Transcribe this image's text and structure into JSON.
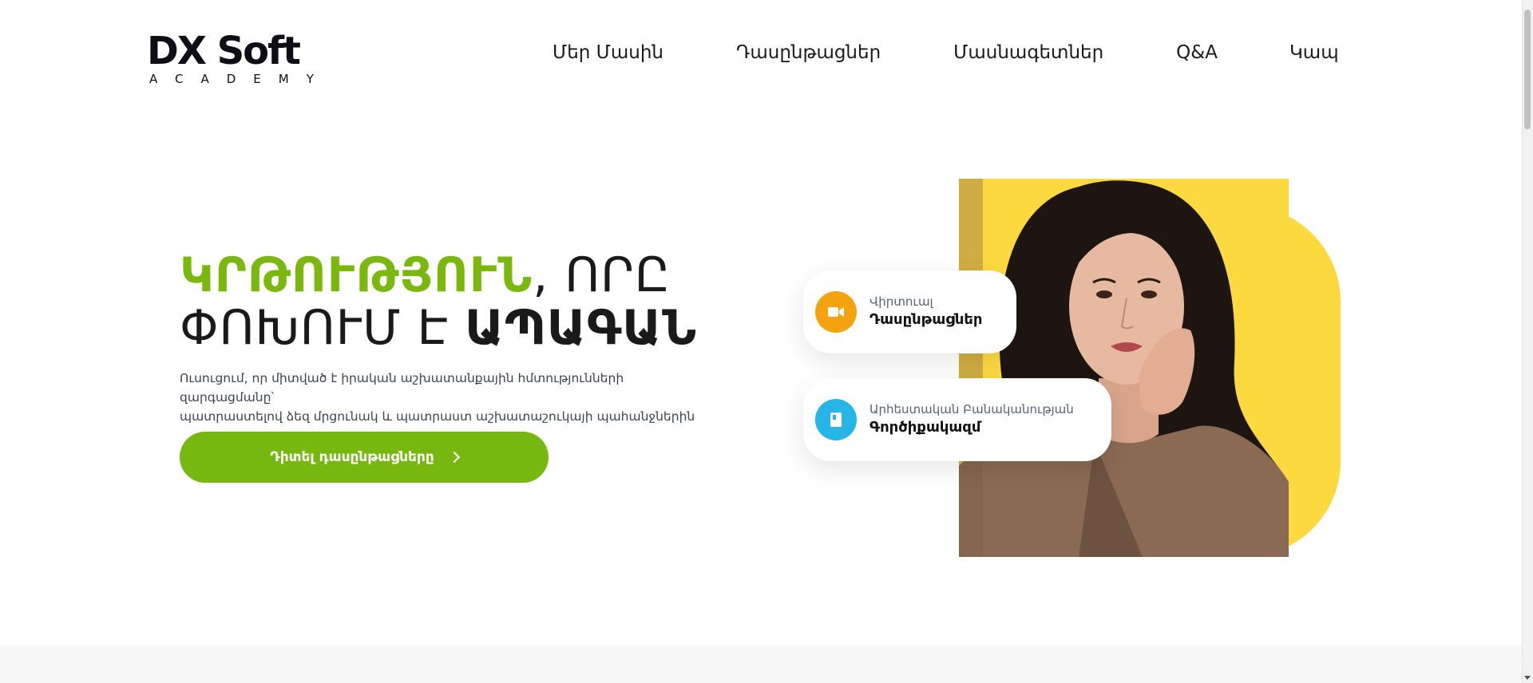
{
  "header": {
    "logo_main": "DX Soft",
    "logo_sub": "ACADEMY",
    "nav": [
      {
        "label": "Մեր Մասին"
      },
      {
        "label": "Դասընթացներ"
      },
      {
        "label": "Մասնագետներ"
      },
      {
        "label": "Q&A"
      },
      {
        "label": "Կապ"
      }
    ]
  },
  "hero": {
    "title_accent": "ԿՐԹՈՒԹՅՈՒՆ",
    "title_part1": ", ՈՐԸ",
    "title_part2": "ՓՈԽՈՒՄ Է ",
    "title_bold": "ԱՊԱԳԱՆ",
    "description_line1": "Ուսուցում, որ միտված է իրական աշխատանքային հմտությունների զարգացմանը՝",
    "description_line2": "պատրաստելով ձեզ մրցունակ և պատրաստ աշխատաշուկայի պահանջներին",
    "cta_label": "Դիտել դասընթացները"
  },
  "cards": [
    {
      "top": "Վիրտուալ",
      "bottom": "Դասընթացներ",
      "icon": "video-camera-icon",
      "color": "#f4a20e"
    },
    {
      "top": "Արհեստական Բանականության",
      "bottom": "Գործիքակազմ",
      "icon": "book-icon",
      "color": "#25b5e6"
    }
  ],
  "colors": {
    "accent_green": "#7ab80e",
    "yellow": "#fdd940"
  }
}
